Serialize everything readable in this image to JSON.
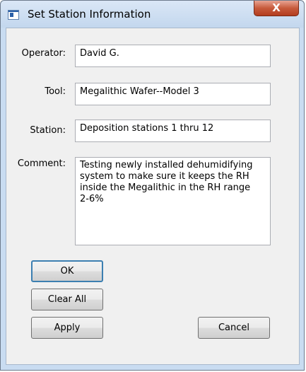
{
  "window": {
    "title": "Set Station Information",
    "close_glyph": "X"
  },
  "form": {
    "operator_label": "Operator:",
    "operator_value": "David G.",
    "tool_label": "Tool:",
    "tool_value": "Megalithic Wafer--Model 3",
    "station_label": "Station:",
    "station_value": "Deposition stations 1 thru 12",
    "comment_label": "Comment:",
    "comment_value": "Testing newly installed dehumidifying\nsystem to make sure it keeps the RH\ninside the Megalithic in the RH range\n2-6%"
  },
  "buttons": {
    "ok": "OK",
    "clear_all": "Clear All",
    "apply": "Apply",
    "cancel": "Cancel"
  },
  "icons": {
    "app": "app-window-icon",
    "close": "close-icon"
  },
  "colors": {
    "titlebar": "#c3d7ee",
    "close_button": "#c75b3c",
    "dialog_bg": "#f0f0f0",
    "default_button_border": "#3c7fb1"
  }
}
